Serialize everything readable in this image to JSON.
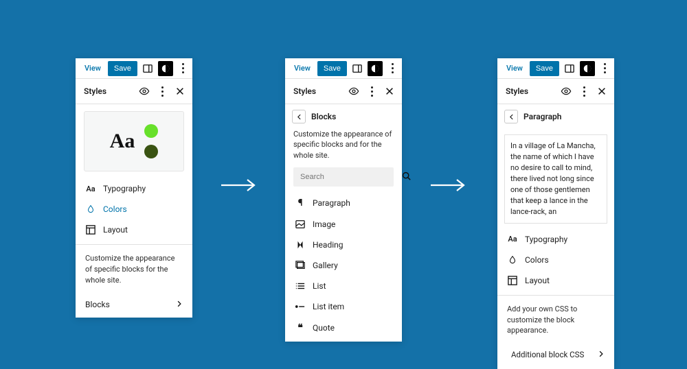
{
  "toolbar": {
    "view": "View",
    "save": "Save"
  },
  "styles_header": "Styles",
  "panel1": {
    "aa": "Aa",
    "menu": {
      "typography": "Typography",
      "colors": "Colors",
      "layout": "Layout"
    },
    "footnote": "Customize the appearance of specific blocks for the whole site.",
    "blocks": "Blocks"
  },
  "panel2": {
    "crumb": "Blocks",
    "desc": "Customize the appearance of specific blocks and for the whole site.",
    "search_placeholder": "Search",
    "items": {
      "paragraph": "Paragraph",
      "image": "Image",
      "heading": "Heading",
      "gallery": "Gallery",
      "list": "List",
      "list_item": "List item",
      "quote": "Quote"
    }
  },
  "panel3": {
    "crumb": "Paragraph",
    "preview": "In a village of La Mancha, the name of which I have no desire to call to mind, there lived not long since one of those gentlemen that keep a lance in the lance-rack, an",
    "menu": {
      "typography": "Typography",
      "colors": "Colors",
      "layout": "Layout"
    },
    "footnote": "Add your own CSS to customize the block appearance.",
    "additional_css": "Additional block CSS"
  }
}
